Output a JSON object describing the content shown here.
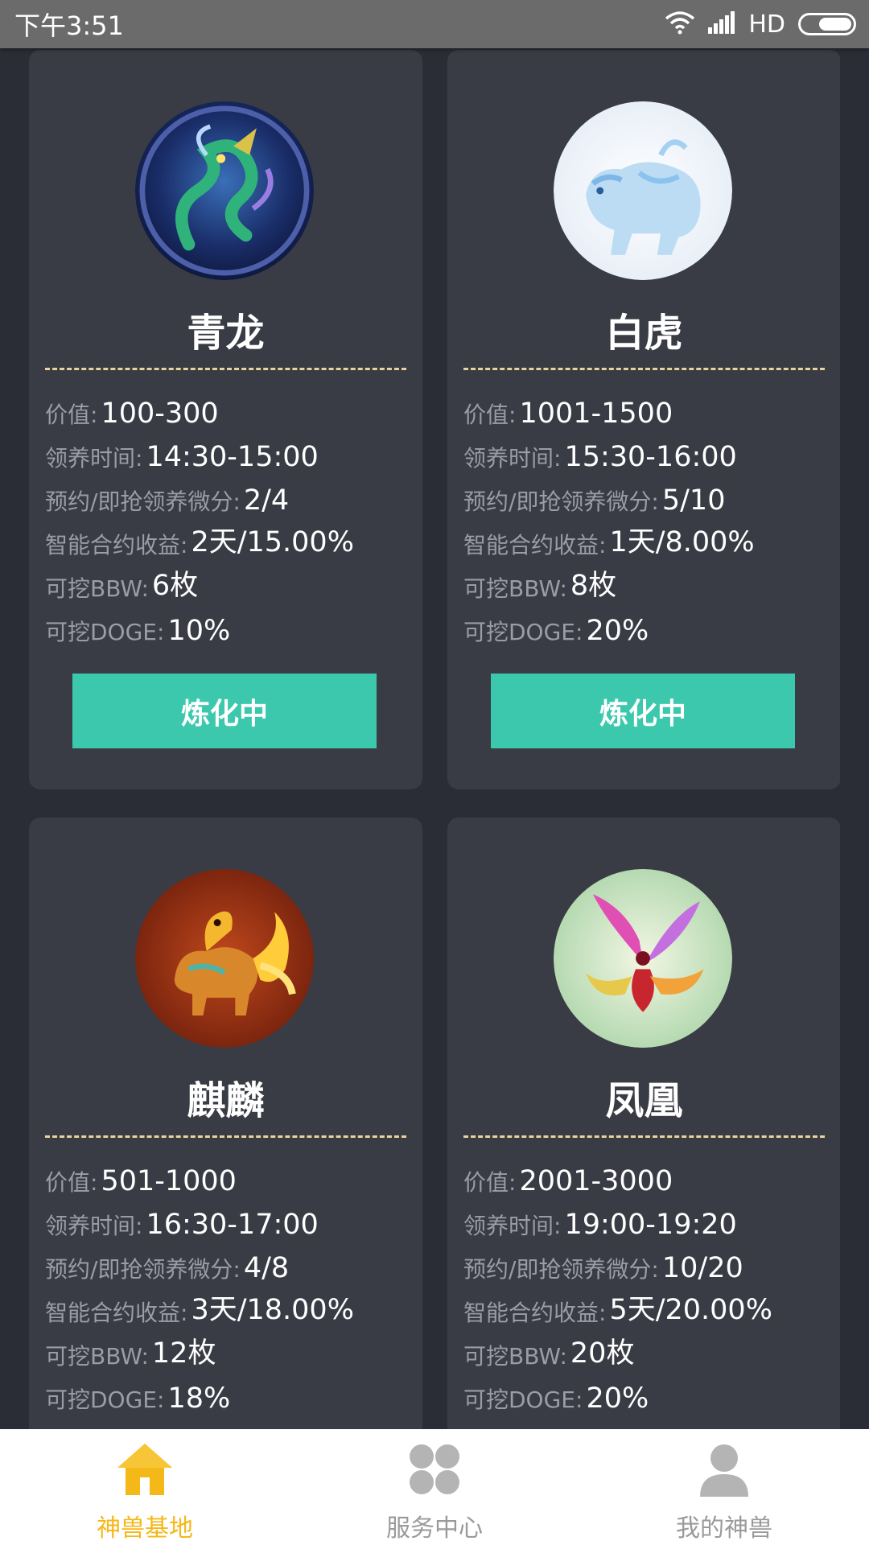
{
  "status_bar": {
    "time": "下午3:51",
    "network": "HD"
  },
  "cards": [
    {
      "name": "青龙",
      "avatar_icon": "azure-dragon-icon",
      "attrs": [
        {
          "label": "价值:",
          "value": "100-300"
        },
        {
          "label": "领养时间:",
          "value": "14:30-15:00"
        },
        {
          "label": "预约/即抢领养微分:",
          "value": "2/4"
        },
        {
          "label": "智能合约收益:",
          "value": "2天/15.00%"
        },
        {
          "label": "可挖BBW:",
          "value": "6枚"
        },
        {
          "label": "可挖DOGE:",
          "value": "10%"
        }
      ],
      "button": "炼化中"
    },
    {
      "name": "白虎",
      "avatar_icon": "white-tiger-icon",
      "attrs": [
        {
          "label": "价值:",
          "value": "1001-1500"
        },
        {
          "label": "领养时间:",
          "value": "15:30-16:00"
        },
        {
          "label": "预约/即抢领养微分:",
          "value": "5/10"
        },
        {
          "label": "智能合约收益:",
          "value": "1天/8.00%"
        },
        {
          "label": "可挖BBW:",
          "value": "8枚"
        },
        {
          "label": "可挖DOGE:",
          "value": "20%"
        }
      ],
      "button": "炼化中"
    },
    {
      "name": "麒麟",
      "avatar_icon": "qilin-icon",
      "attrs": [
        {
          "label": "价值:",
          "value": "501-1000"
        },
        {
          "label": "领养时间:",
          "value": "16:30-17:00"
        },
        {
          "label": "预约/即抢领养微分:",
          "value": "4/8"
        },
        {
          "label": "智能合约收益:",
          "value": "3天/18.00%"
        },
        {
          "label": "可挖BBW:",
          "value": "12枚"
        },
        {
          "label": "可挖DOGE:",
          "value": "18%"
        }
      ]
    },
    {
      "name": "凤凰",
      "avatar_icon": "phoenix-icon",
      "attrs": [
        {
          "label": "价值:",
          "value": "2001-3000"
        },
        {
          "label": "领养时间:",
          "value": "19:00-19:20"
        },
        {
          "label": "预约/即抢领养微分:",
          "value": "10/20"
        },
        {
          "label": "智能合约收益:",
          "value": "5天/20.00%"
        },
        {
          "label": "可挖BBW:",
          "value": "20枚"
        },
        {
          "label": "可挖DOGE:",
          "value": "20%"
        }
      ]
    }
  ],
  "tabbar": [
    {
      "label": "神兽基地",
      "icon": "home-icon",
      "active": true
    },
    {
      "label": "服务中心",
      "icon": "grid-icon",
      "active": false
    },
    {
      "label": "我的神兽",
      "icon": "user-icon",
      "active": false
    }
  ],
  "colors": {
    "background": "#2a2d35",
    "card": "#393c44",
    "button": "#3cc8ad",
    "divider": "#e8d49a",
    "tab_active": "#f5b819",
    "tab_inactive": "#9a9a9a"
  }
}
